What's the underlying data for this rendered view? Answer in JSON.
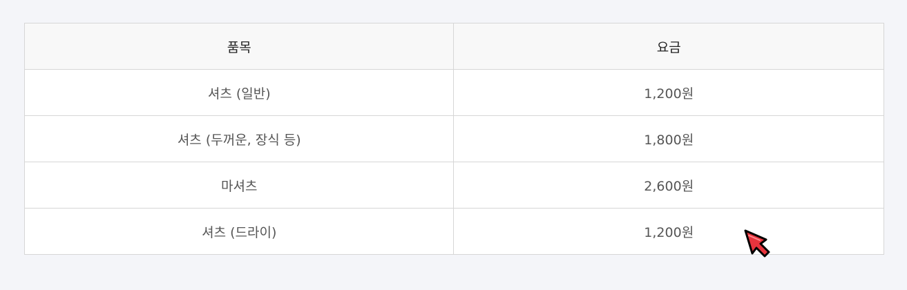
{
  "table": {
    "headers": {
      "item": "품목",
      "price": "요금"
    },
    "rows": [
      {
        "item": "셔츠 (일반)",
        "price": "1,200원"
      },
      {
        "item": "셔츠 (두꺼운, 장식 등)",
        "price": "1,800원"
      },
      {
        "item": "마셔츠",
        "price": "2,600원"
      },
      {
        "item": "셔츠 (드라이)",
        "price": "1,200원"
      }
    ]
  },
  "cursor": {
    "icon": "arrow-cursor-icon",
    "color": "#e8343d"
  }
}
